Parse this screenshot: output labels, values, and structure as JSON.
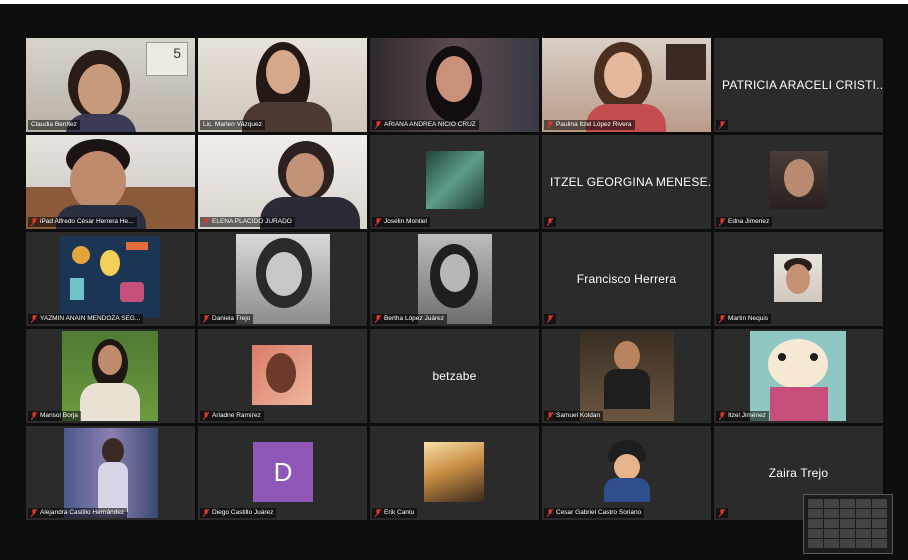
{
  "participants": [
    {
      "name": "Claudia Benítez",
      "muted": false,
      "video": true,
      "active": true
    },
    {
      "name": "Lic. Marlen Vázquez",
      "muted": false,
      "video": true
    },
    {
      "name": "ARIANA ANDREA NICIO CRUZ",
      "muted": true,
      "video": true
    },
    {
      "name": "Paulina Itzel López Rivera",
      "muted": true,
      "video": true
    },
    {
      "name": "",
      "display_name": "PATRICIA ARACELI CRISTI...",
      "muted": true,
      "video": false
    },
    {
      "name": "iPad Alfredo César Herrera He...",
      "muted": true,
      "video": true
    },
    {
      "name": "ELENA PLACIDO JURADO",
      "muted": true,
      "video": true
    },
    {
      "name": "Joselin Montiel",
      "muted": true,
      "video": true
    },
    {
      "name": "",
      "display_name": "ITZEL GEORGINA MENESE...",
      "muted": true,
      "video": false
    },
    {
      "name": "Edna Jimenez",
      "muted": true,
      "video": true
    },
    {
      "name": "YAZMIN ANAIN MENDOZA SEG...",
      "muted": true,
      "video": true
    },
    {
      "name": "Daniela Trejo",
      "muted": true,
      "video": true
    },
    {
      "name": "Bertha López Juárez",
      "muted": true,
      "video": true
    },
    {
      "name": "",
      "display_name": "Francisco Herrera",
      "muted": true,
      "video": false
    },
    {
      "name": "Martin Nequis",
      "muted": true,
      "video": true
    },
    {
      "name": "Marisol Borja",
      "muted": true,
      "video": true
    },
    {
      "name": "Ariadne Ramírez",
      "muted": true,
      "video": true
    },
    {
      "name": "",
      "display_name": "betzabe",
      "muted": false,
      "video": false
    },
    {
      "name": "Samuel Koldan",
      "muted": true,
      "video": true
    },
    {
      "name": "Itzel Jiménez",
      "muted": true,
      "video": true
    },
    {
      "name": "Alejandra Castillo Hernández",
      "muted": true,
      "video": true
    },
    {
      "name": "Diego Castillo Juárez",
      "muted": true,
      "video": false,
      "avatar_letter": "D"
    },
    {
      "name": "Erik Cantu",
      "muted": true,
      "video": true
    },
    {
      "name": "Cesar Gabriel Castro Soriano",
      "muted": true,
      "video": true
    },
    {
      "name": "",
      "display_name": "Zaira Trejo",
      "muted": true,
      "video": false
    }
  ],
  "calendar_number": "5",
  "colors": {
    "background": "#0d0d0d",
    "tile": "#2b2b2b",
    "active_border": "#d8e35a",
    "muted_icon": "#e0362c",
    "avatar_purple": "#8e57b8"
  },
  "icons": {
    "muted": "mic-muted-icon"
  }
}
